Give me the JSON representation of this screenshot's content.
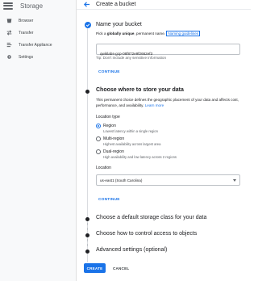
{
  "sidebar": {
    "title": "Storage",
    "items": [
      {
        "label": "Browser",
        "icon": "bucket-icon"
      },
      {
        "label": "Transfer",
        "icon": "transfer-icon"
      },
      {
        "label": "Transfer Appliance",
        "icon": "appliance-icon"
      },
      {
        "label": "Settings",
        "icon": "gear-icon"
      }
    ]
  },
  "header": {
    "title": "Create a bucket"
  },
  "step1": {
    "title": "Name your bucket",
    "desc_pre": "Pick a ",
    "desc_bold": "globally unique",
    "desc_post": ", permanent name.",
    "guidelines_link": "Naming guidelines",
    "bucket_name": "qwiklabs-gcp-08f872e9f2662ef3",
    "tip": "Tip: Don't include any sensitive information",
    "continue_label": "CONTINUE"
  },
  "step2": {
    "title": "Choose where to store your data",
    "desc": "This permanent choice defines the geographic placement of your data and affects cost, performance, and availability.",
    "learn_more": "Learn more",
    "location_type_heading": "Location type",
    "options": [
      {
        "label": "Region",
        "desc": "Lowest latency within a single region",
        "checked": true
      },
      {
        "label": "Multi-region",
        "desc": "Highest availability across largest area",
        "checked": false
      },
      {
        "label": "Dual-region",
        "desc": "High availability and low latency across 2 regions",
        "checked": false
      }
    ],
    "location_heading": "Location",
    "location_value": "us-east1 (South Carolina)",
    "continue_label": "CONTINUE"
  },
  "step3": {
    "title": "Choose a default storage class for your data"
  },
  "step4": {
    "title": "Choose how to control access to objects"
  },
  "step5": {
    "title": "Advanced settings (optional)"
  },
  "actions": {
    "create_label": "CREATE",
    "cancel_label": "CANCEL"
  },
  "colors": {
    "accent": "#1a73e8",
    "sidebar_bg": "#f8f9fa",
    "text": "#202124",
    "muted": "#5f6368"
  }
}
